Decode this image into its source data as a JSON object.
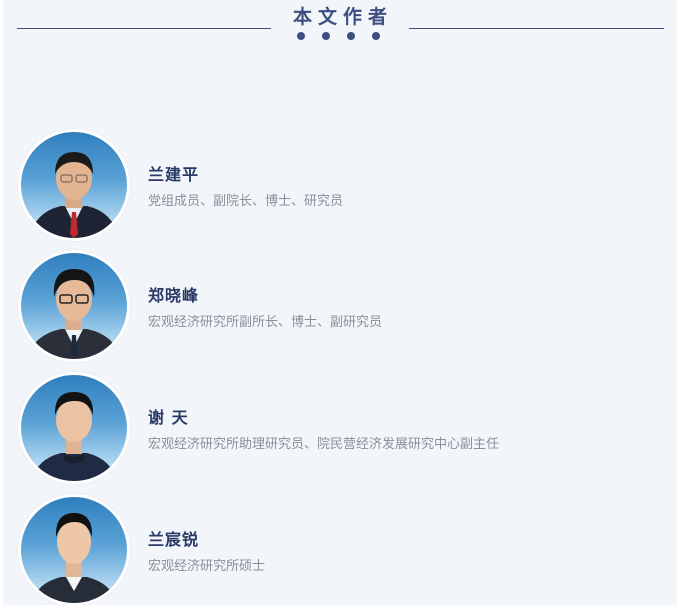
{
  "header": {
    "title": "本文作者"
  },
  "authors": [
    {
      "name": "兰建平",
      "role": "党组成员、副院长、博士、研究员"
    },
    {
      "name": "郑晓峰",
      "role": "宏观经济研究所副所长、博士、副研究员"
    },
    {
      "name": "谢 天",
      "role": "宏观经济研究所助理研究员、院民营经济发展研究中心副主任"
    },
    {
      "name": "兰宸锐",
      "role": "宏观经济研究所硕士"
    }
  ],
  "colors": {
    "accent": "#3d4f80",
    "background": "#f2f5fa",
    "name_text": "#2a3a66",
    "role_text": "#8a8f99"
  }
}
